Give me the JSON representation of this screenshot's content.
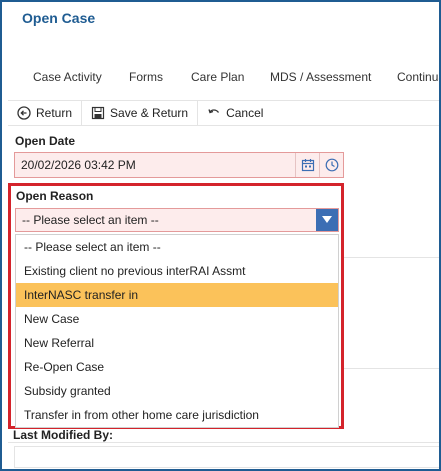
{
  "page": {
    "title": "Open Case"
  },
  "tabs": [
    {
      "label": "Case Activity"
    },
    {
      "label": "Forms"
    },
    {
      "label": "Care Plan"
    },
    {
      "label": "MDS / Assessment"
    },
    {
      "label": "Continua"
    }
  ],
  "toolbar": {
    "return_label": "Return",
    "save_return_label": "Save & Return",
    "cancel_label": "Cancel"
  },
  "open_date": {
    "label": "Open Date",
    "value": "20/02/2026 03:42 PM"
  },
  "open_reason": {
    "label": "Open Reason",
    "selected": "-- Please select an item --",
    "highlighted_option": "InterNASC transfer in",
    "options": [
      "-- Please select an item --",
      "Existing client no previous interRAI Assmt",
      "InterNASC transfer in",
      "New Case",
      "New Referral",
      "Re-Open Case",
      "Subsidy granted",
      "Transfer in from other home care jurisdiction"
    ]
  },
  "last_modified": {
    "label": "Last Modified By:"
  },
  "colors": {
    "title": "#1f5c92",
    "border_highlight": "#d4232b",
    "required_bg": "#fdecec",
    "option_highlight": "#fbc25a",
    "select_arrow_bg": "#3c6eb4"
  }
}
